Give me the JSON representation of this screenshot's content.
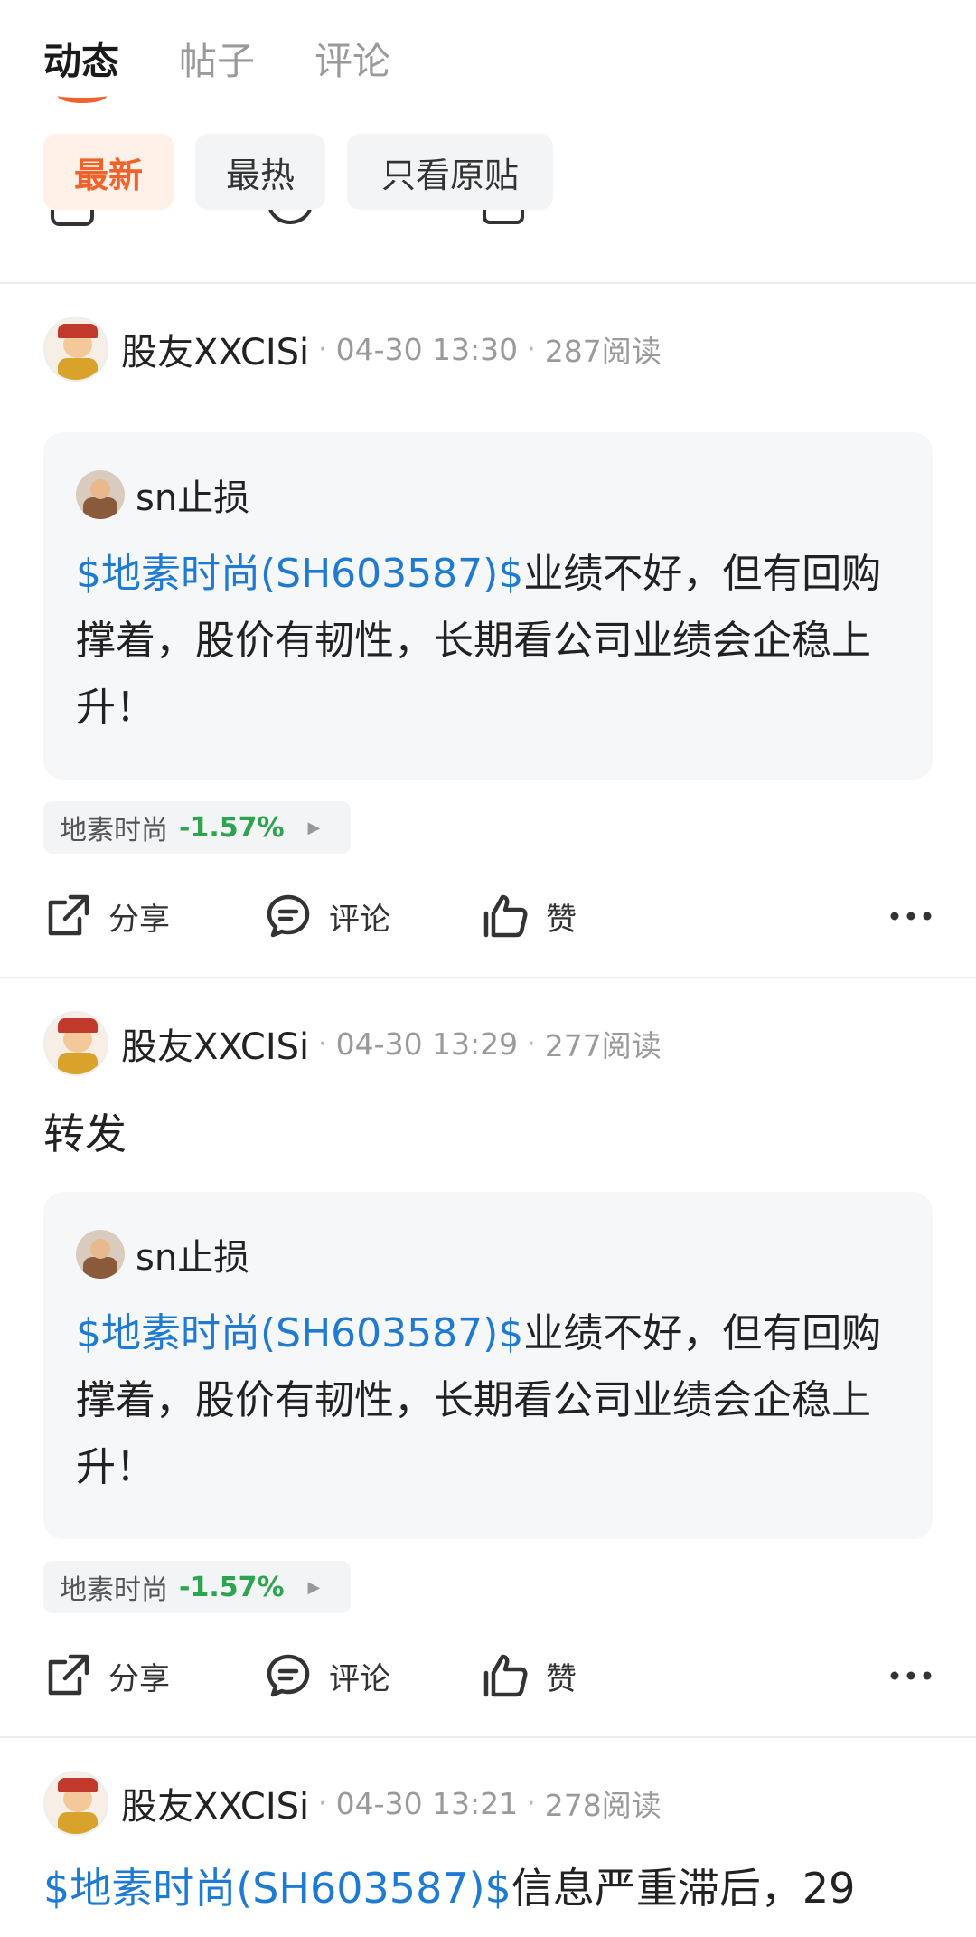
{
  "tabs": [
    {
      "label": "动态",
      "active": true
    },
    {
      "label": "帖子",
      "active": false
    },
    {
      "label": "评论",
      "active": false
    }
  ],
  "filters": [
    {
      "label": "最新",
      "active": true
    },
    {
      "label": "最热",
      "active": false
    },
    {
      "label": "只看原贴",
      "active": false
    }
  ],
  "actions": {
    "share": "分享",
    "comment": "评论",
    "like": "赞"
  },
  "posts": [
    {
      "author": "股友XXCISi",
      "time": "04-30 13:30",
      "reads": "287阅读",
      "quote": {
        "author": "sn止损",
        "stock_link": "$地素时尚(SH603587)$",
        "text": "业绩不好，但有回购撑着，股价有韧性，长期看公司业绩会企稳上升！"
      },
      "stock_tag": {
        "name": "地素时尚",
        "change": "-1.57%"
      }
    },
    {
      "author": "股友XXCISi",
      "time": "04-30 13:29",
      "reads": "277阅读",
      "body": "转发",
      "quote": {
        "author": "sn止损",
        "stock_link": "$地素时尚(SH603587)$",
        "text": "业绩不好，但有回购撑着，股价有韧性，长期看公司业绩会企稳上升！"
      },
      "stock_tag": {
        "name": "地素时尚",
        "change": "-1.57%"
      }
    },
    {
      "author": "股友XXCISi",
      "time": "04-30 13:21",
      "reads": "278阅读",
      "stock_link": "$地素时尚(SH603587)$",
      "text": "信息严重滞后，29"
    }
  ]
}
